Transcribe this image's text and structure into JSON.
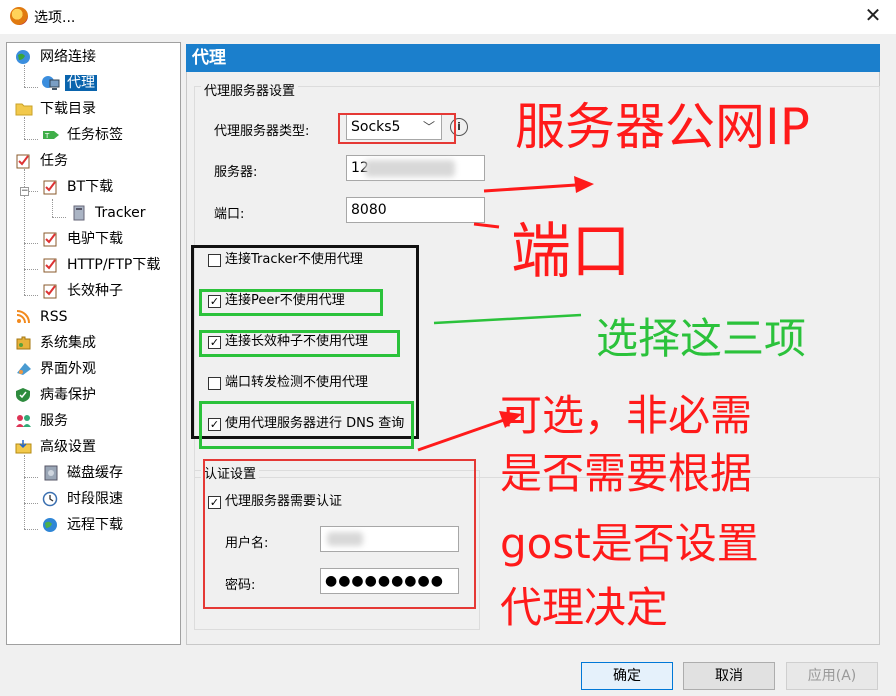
{
  "window": {
    "title": "选项...",
    "close_glyph": "✕"
  },
  "tree": {
    "items": [
      {
        "label": "网络连接",
        "icon": "globe-network-icon"
      },
      {
        "label": "代理",
        "icon": "proxy-computer-icon",
        "selected": true
      },
      {
        "label": "下载目录",
        "icon": "folder-icon"
      },
      {
        "label": "任务标签",
        "icon": "tag-icon"
      },
      {
        "label": "任务",
        "icon": "task-clipboard-icon"
      },
      {
        "label": "BT下载",
        "icon": "task-clipboard-icon"
      },
      {
        "label": "Tracker",
        "icon": "server-icon"
      },
      {
        "label": "电驴下载",
        "icon": "task-clipboard-icon"
      },
      {
        "label": "HTTP/FTP下载",
        "icon": "task-clipboard-icon"
      },
      {
        "label": "长效种子",
        "icon": "task-clipboard-icon"
      },
      {
        "label": "RSS",
        "icon": "rss-icon"
      },
      {
        "label": "系统集成",
        "icon": "puzzle-icon"
      },
      {
        "label": "界面外观",
        "icon": "palette-icon"
      },
      {
        "label": "病毒保护",
        "icon": "shield-icon"
      },
      {
        "label": "服务",
        "icon": "users-icon"
      },
      {
        "label": "高级设置",
        "icon": "settings-tray-icon"
      },
      {
        "label": "磁盘缓存",
        "icon": "disk-cache-icon"
      },
      {
        "label": "时段限速",
        "icon": "clock-icon"
      },
      {
        "label": "远程下载",
        "icon": "globe-icon"
      }
    ]
  },
  "panel": {
    "title": "代理",
    "server_group": {
      "legend": "代理服务器设置",
      "type_label": "代理服务器类型:",
      "type_value": "Socks5",
      "type_options": [
        "Socks5"
      ],
      "server_label": "服务器:",
      "server_value": "12",
      "port_label": "端口:",
      "port_value": "8080",
      "checkboxes": [
        {
          "label": "连接Tracker不使用代理",
          "checked": false
        },
        {
          "label": "连接Peer不使用代理",
          "checked": true
        },
        {
          "label": "连接长效种子不使用代理",
          "checked": true
        },
        {
          "label": "端口转发检测不使用代理",
          "checked": false
        },
        {
          "label": "使用代理服务器进行 DNS 查询",
          "checked": true
        }
      ]
    },
    "auth_group": {
      "legend": "认证设置",
      "require_label": "代理服务器需要认证",
      "require_checked": true,
      "username_label": "用户名:",
      "username_value": "",
      "password_label": "密码:",
      "password_value": "●●●●●●●●●"
    }
  },
  "buttons": {
    "ok": "确定",
    "cancel": "取消",
    "apply": "应用(A)"
  },
  "annotations": {
    "server_ip": "服务器公网IP",
    "port": "端口",
    "choose_three": "选择这三项",
    "optional_lines": [
      "可选，非必需",
      "是否需要根据",
      "gost是否设置",
      "代理决定"
    ]
  },
  "colors": {
    "annotation_red": "#ff1a1a",
    "annotation_green": "#2bc23b",
    "selection": "#0a64ad",
    "title_bar_blue": "#1b7fcc"
  }
}
